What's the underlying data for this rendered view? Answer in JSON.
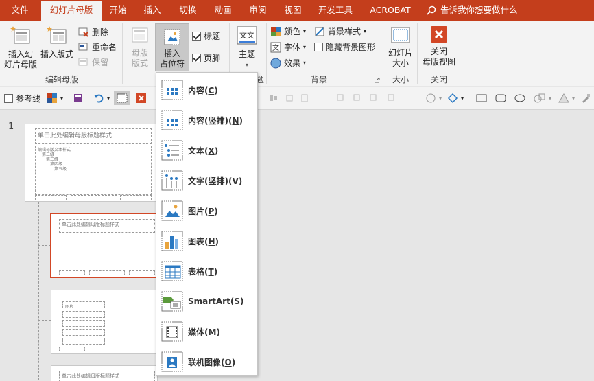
{
  "tabs": {
    "file": "文件",
    "slide_master": "幻灯片母版",
    "home": "开始",
    "insert": "插入",
    "transitions": "切换",
    "animations": "动画",
    "review": "审阅",
    "view": "视图",
    "developer": "开发工具",
    "acrobat": "ACROBAT",
    "tell_me": "告诉我你想要做什么"
  },
  "ribbon": {
    "insert_slide_master": "插入幻\n灯片母版",
    "insert_layout": "插入版式",
    "delete": "删除",
    "rename": "重命名",
    "preserve": "保留",
    "group_edit_master": "编辑母版",
    "master_layout": "母版\n版式",
    "insert_placeholder": "插入\n占位符",
    "title_checkbox": "标题",
    "footer_checkbox": "页脚",
    "theme": "主题",
    "colors": "颜色",
    "fonts": "字体",
    "effects": "效果",
    "background_styles": "背景样式",
    "hide_background_graphics": "隐藏背景图形",
    "group_background": "背景",
    "slide_size": "幻灯片\n大小",
    "group_size": "大小",
    "close_master_view": "关闭\n母版视图",
    "group_close": "关闭",
    "group_theme_partial": "题"
  },
  "quickbar": {
    "guides": "参考线"
  },
  "slide_panel": {
    "slide_number": "1",
    "master_title": "单击此处编辑母版标题样式",
    "master_text_l1": "编辑母版文本样式",
    "master_text_l2": "第二级",
    "master_text_l3": "第三级",
    "master_text_l4": "第四级",
    "master_text_l5": "第五级",
    "layout1_title": "单击此处编辑母版标题样式",
    "layout2_label": "图片",
    "layout3_title": "单击此处编辑母版标题样式"
  },
  "placeholder_menu": {
    "items": [
      {
        "label": "内容",
        "key": "C"
      },
      {
        "label": "内容(竖排)",
        "key": "N"
      },
      {
        "label": "文本",
        "key": "X"
      },
      {
        "label": "文字(竖排)",
        "key": "V"
      },
      {
        "label": "图片",
        "key": "P"
      },
      {
        "label": "图表",
        "key": "H"
      },
      {
        "label": "表格",
        "key": "T"
      },
      {
        "label": "SmartArt",
        "key": "S"
      },
      {
        "label": "媒体",
        "key": "M"
      },
      {
        "label": "联机图像",
        "key": "O"
      }
    ]
  },
  "colors": {
    "accent": "#c43e1c",
    "selected_border": "#d24726"
  }
}
